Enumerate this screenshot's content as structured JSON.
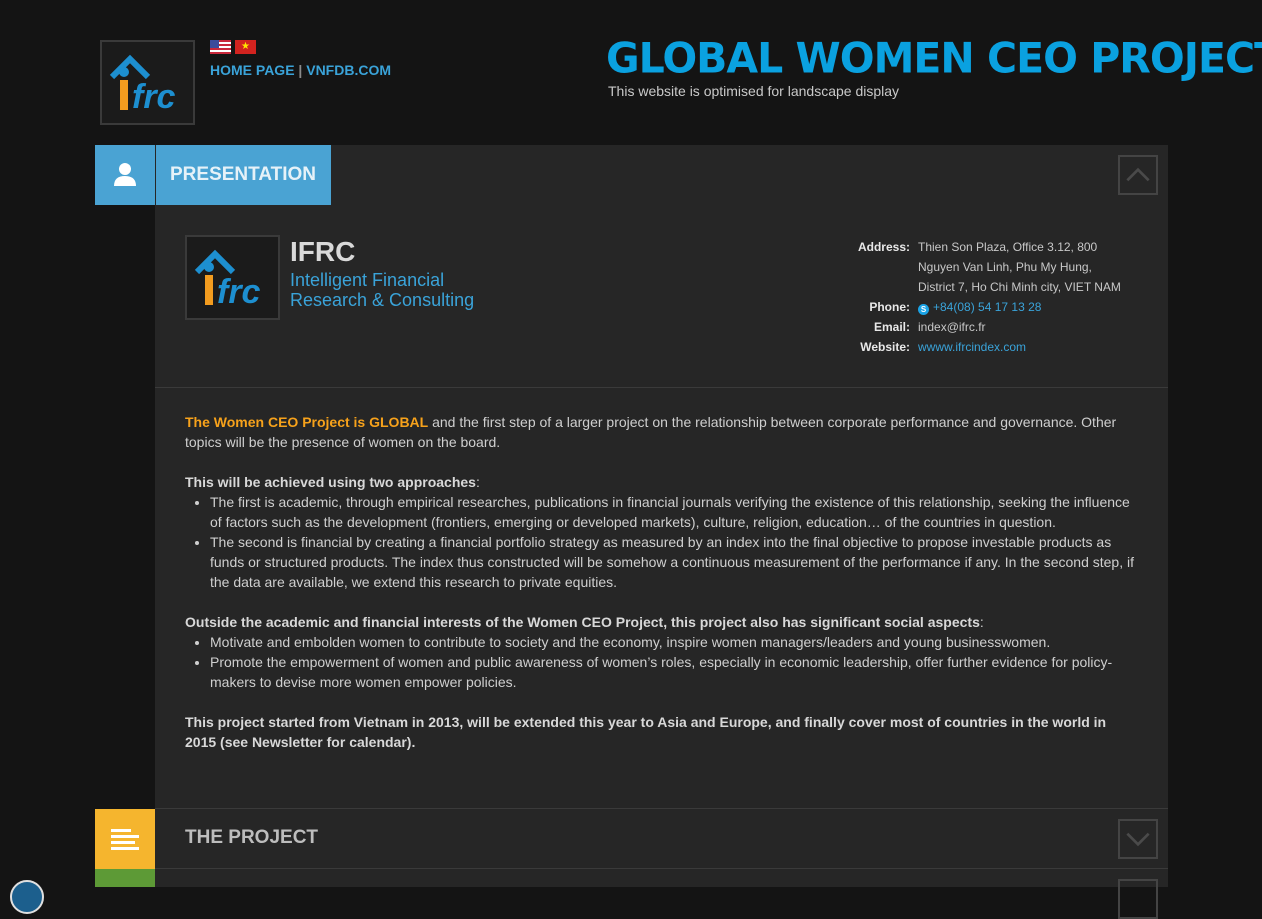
{
  "header": {
    "flags": [
      "us-flag-icon",
      "vn-flag-icon"
    ],
    "home_link": "HOME PAGE",
    "separator": "|",
    "vnfdb_link": "VNFDB.COM",
    "title": "GLOBAL WOMEN CEO PROJECT",
    "subtitle": "This website is optimised for landscape display"
  },
  "presentation": {
    "tab_label": "PRESENTATION",
    "company_name": "IFRC",
    "company_sub1": "Intelligent Financial",
    "company_sub2": "Research & Consulting",
    "contact": {
      "address_label": "Address:",
      "address_line1": "Thien Son Plaza, Office 3.12, 800",
      "address_line2": "Nguyen Van Linh, Phu My Hung,",
      "address_line3": "District 7, Ho Chi Minh city, VIET NAM",
      "phone_label": "Phone:",
      "phone": "+84(08) 54 17 13 28",
      "email_label": "Email:",
      "email": "index@ifrc.fr",
      "website_label": "Website:",
      "website": "wwww.ifrcindex.com"
    },
    "intro_highlight": "The Women CEO Project is GLOBAL",
    "intro_rest": " and the first step of a larger project on the relationship between corporate performance and governance. Other topics will be the presence of women on the board.",
    "approaches_title": "This will be achieved using two approaches",
    "approaches_colon": ":",
    "approach1": "The first is academic, through empirical researches, publications in financial journals verifying the existence of this relationship, seeking the influence of factors such as the development (frontiers, emerging or developed markets), culture, religion, education… of the countries in question.",
    "approach2": "The second is financial by creating a financial portfolio strategy as measured by an index into the final objective to propose investable products as funds or structured products. The index thus constructed will be somehow a continuous measurement of the performance if any. In the second step, if the data are available, we extend this research to private equities.",
    "social_title": "Outside the academic and financial interests of the Women CEO Project, this project also has significant social aspects",
    "social_colon": ":",
    "social1": "Motivate and embolden women to contribute to society and the economy, inspire women managers/leaders and young businesswomen.",
    "social2": "Promote the empowerment of women and public awareness of women’s roles, especially in economic leadership, offer further evidence for policy-makers to devise more women empower policies.",
    "closing": "This project started from Vietnam in 2013, will be extended this year to Asia and Europe, and finally cover most of countries in the world in 2015 (see Newsletter for calendar)."
  },
  "project": {
    "tab_label": "THE PROJECT"
  },
  "colors": {
    "accent_blue": "#4aa3d3",
    "title_blue": "#0aa1e0",
    "orange": "#f7a21b",
    "project_yellow": "#f5b52e",
    "green": "#5d9a36"
  }
}
